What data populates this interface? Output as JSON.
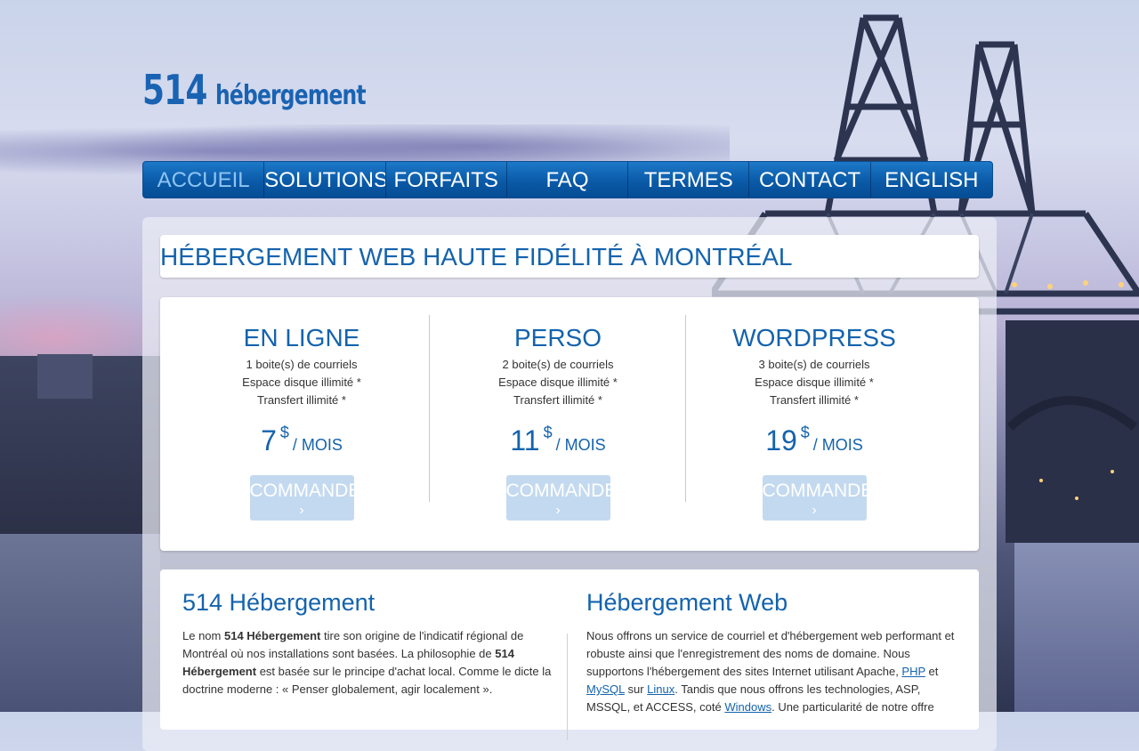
{
  "logo": {
    "number": "514",
    "word": "hébergement"
  },
  "nav": {
    "items": [
      {
        "label": "ACCUEIL",
        "active": true
      },
      {
        "label": "SOLUTIONS",
        "active": false
      },
      {
        "label": "FORFAITS",
        "active": false
      },
      {
        "label": "FAQ",
        "active": false
      },
      {
        "label": "TERMES",
        "active": false
      },
      {
        "label": "CONTACT",
        "active": false
      },
      {
        "label": "ENGLISH",
        "active": false
      }
    ]
  },
  "headline": "HÉBERGEMENT WEB HAUTE FIDÉLITÉ À MONTRÉAL",
  "plans": [
    {
      "name": "EN LIGNE",
      "features": [
        "1 boite(s) de courriels",
        "Espace disque illimité *",
        "Transfert illimité *"
      ],
      "price": "7",
      "currency": "$",
      "period": "/ MOIS",
      "button": "COMMANDER"
    },
    {
      "name": "PERSO",
      "features": [
        "2 boite(s) de courriels",
        "Espace disque illimité *",
        "Transfert illimité *"
      ],
      "price": "11",
      "currency": "$",
      "period": "/ MOIS",
      "button": "COMMANDER"
    },
    {
      "name": "WORDPRESS",
      "features": [
        "3 boite(s) de courriels",
        "Espace disque illimité *",
        "Transfert illimité *"
      ],
      "price": "19",
      "currency": "$",
      "period": "/ MOIS",
      "button": "COMMANDER"
    }
  ],
  "button_chevron": "›",
  "info": {
    "left": {
      "title": "514 Hébergement",
      "p1": "Le nom ",
      "b1": "514 Hébergement",
      "p2": " tire son origine de l'indicatif régional de Montréal où nos installations sont basées. La philosophie de ",
      "b2": "514 Hébergement",
      "p3": " est basée sur le principe d'achat local. Comme le dicte la doctrine moderne : « Penser globalement, agir localement »."
    },
    "right": {
      "title": "Hébergement Web",
      "t1": "Nous offrons un service de courriel et d'hébergement web performant et robuste ainsi que l'enregistrement des noms de domaine. Nous supportons l'hébergement des sites Internet utilisant Apache, ",
      "link_php": "PHP",
      "t2": " et ",
      "link_mysql": "MySQL",
      "t3": " sur ",
      "link_linux": "Linux",
      "t4": ". Tandis que nous offrons les technologies, ASP, MSSQL, et ACCESS, coté ",
      "link_windows": "Windows",
      "t5": ". Une particularité de notre offre"
    }
  },
  "colors": {
    "brand_blue": "#1463ad",
    "nav_blue": "#0a5aa8",
    "nav_active": "#8fc4f2",
    "button": "#c3d9ef"
  }
}
